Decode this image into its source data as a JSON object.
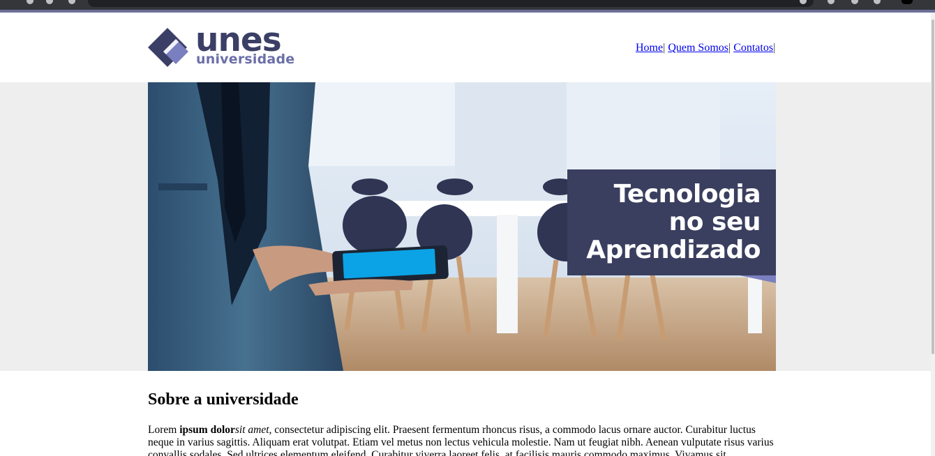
{
  "logo": {
    "word_big": "unes",
    "word_small": "universidade",
    "color_primary": "#3b3f66",
    "color_secondary": "#6b6fa8"
  },
  "nav": {
    "items": [
      {
        "label": "Home"
      },
      {
        "label": "Quem Somos"
      },
      {
        "label": "Contatos"
      }
    ],
    "separator": "|"
  },
  "banner": {
    "tagline": [
      "Tecnologia",
      "no seu",
      "Aprendizado"
    ],
    "tagline_bg": "#3a3f5f",
    "band_bg": "#eeeeee"
  },
  "about": {
    "title": "Sobre a universidade",
    "p_start": "Lorem ",
    "p_bold": "ipsum dolor",
    "p_italic": "sit amet",
    "p_rest": ", consectetur adipiscing elit. Praesent fermentum rhoncus risus, a commodo lacus ornare auctor. Curabitur luctus neque in varius sagittis. Aliquam erat volutpat. Etiam vel metus non lectus vehicula molestie. Nam ut feugiat nibh. Aenean vulputate risus varius convallis sodales. Sed ultrices elementum eleifend. Curabitur viverra laoreet felis, at facilisis mauris commodo maximus. Vivamus sit"
  }
}
